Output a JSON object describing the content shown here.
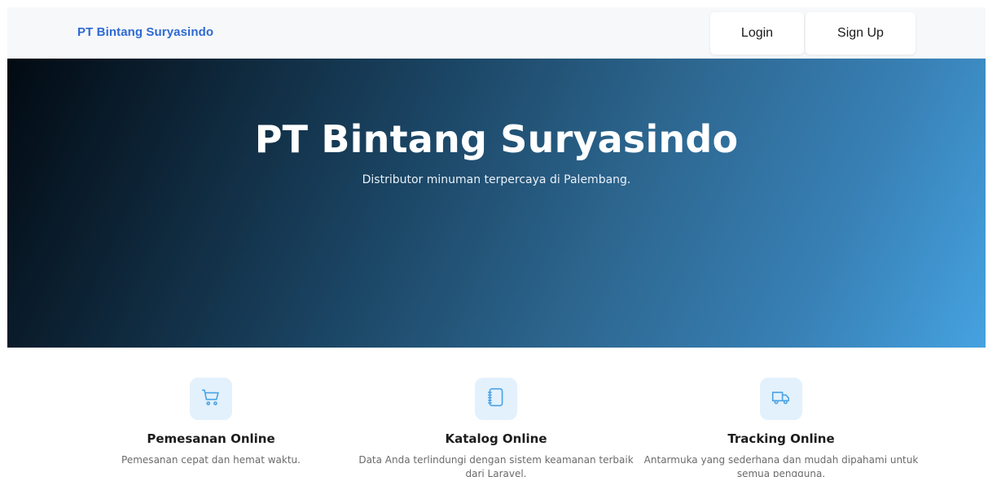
{
  "navbar": {
    "brand": "PT Bintang Suryasindo",
    "login_label": "Login",
    "signup_label": "Sign Up"
  },
  "hero": {
    "title": "PT Bintang Suryasindo",
    "subtitle": "Distributor minuman terpercaya di Palembang."
  },
  "features": [
    {
      "icon": "shopping-cart-icon",
      "title": "Pemesanan Online",
      "description": "Pemesanan cepat dan hemat waktu."
    },
    {
      "icon": "notebook-icon",
      "title": "Katalog Online",
      "description": "Data Anda terlindungi dengan sistem keamanan terbaik dari Laravel."
    },
    {
      "icon": "truck-icon",
      "title": "Tracking Online",
      "description": "Antarmuka yang sederhana dan mudah dipahami untuk semua pengguna."
    }
  ],
  "colors": {
    "brand": "#2e6ad1",
    "icon_stroke": "#4aa3e6",
    "icon_bg": "#e3f1fc"
  }
}
